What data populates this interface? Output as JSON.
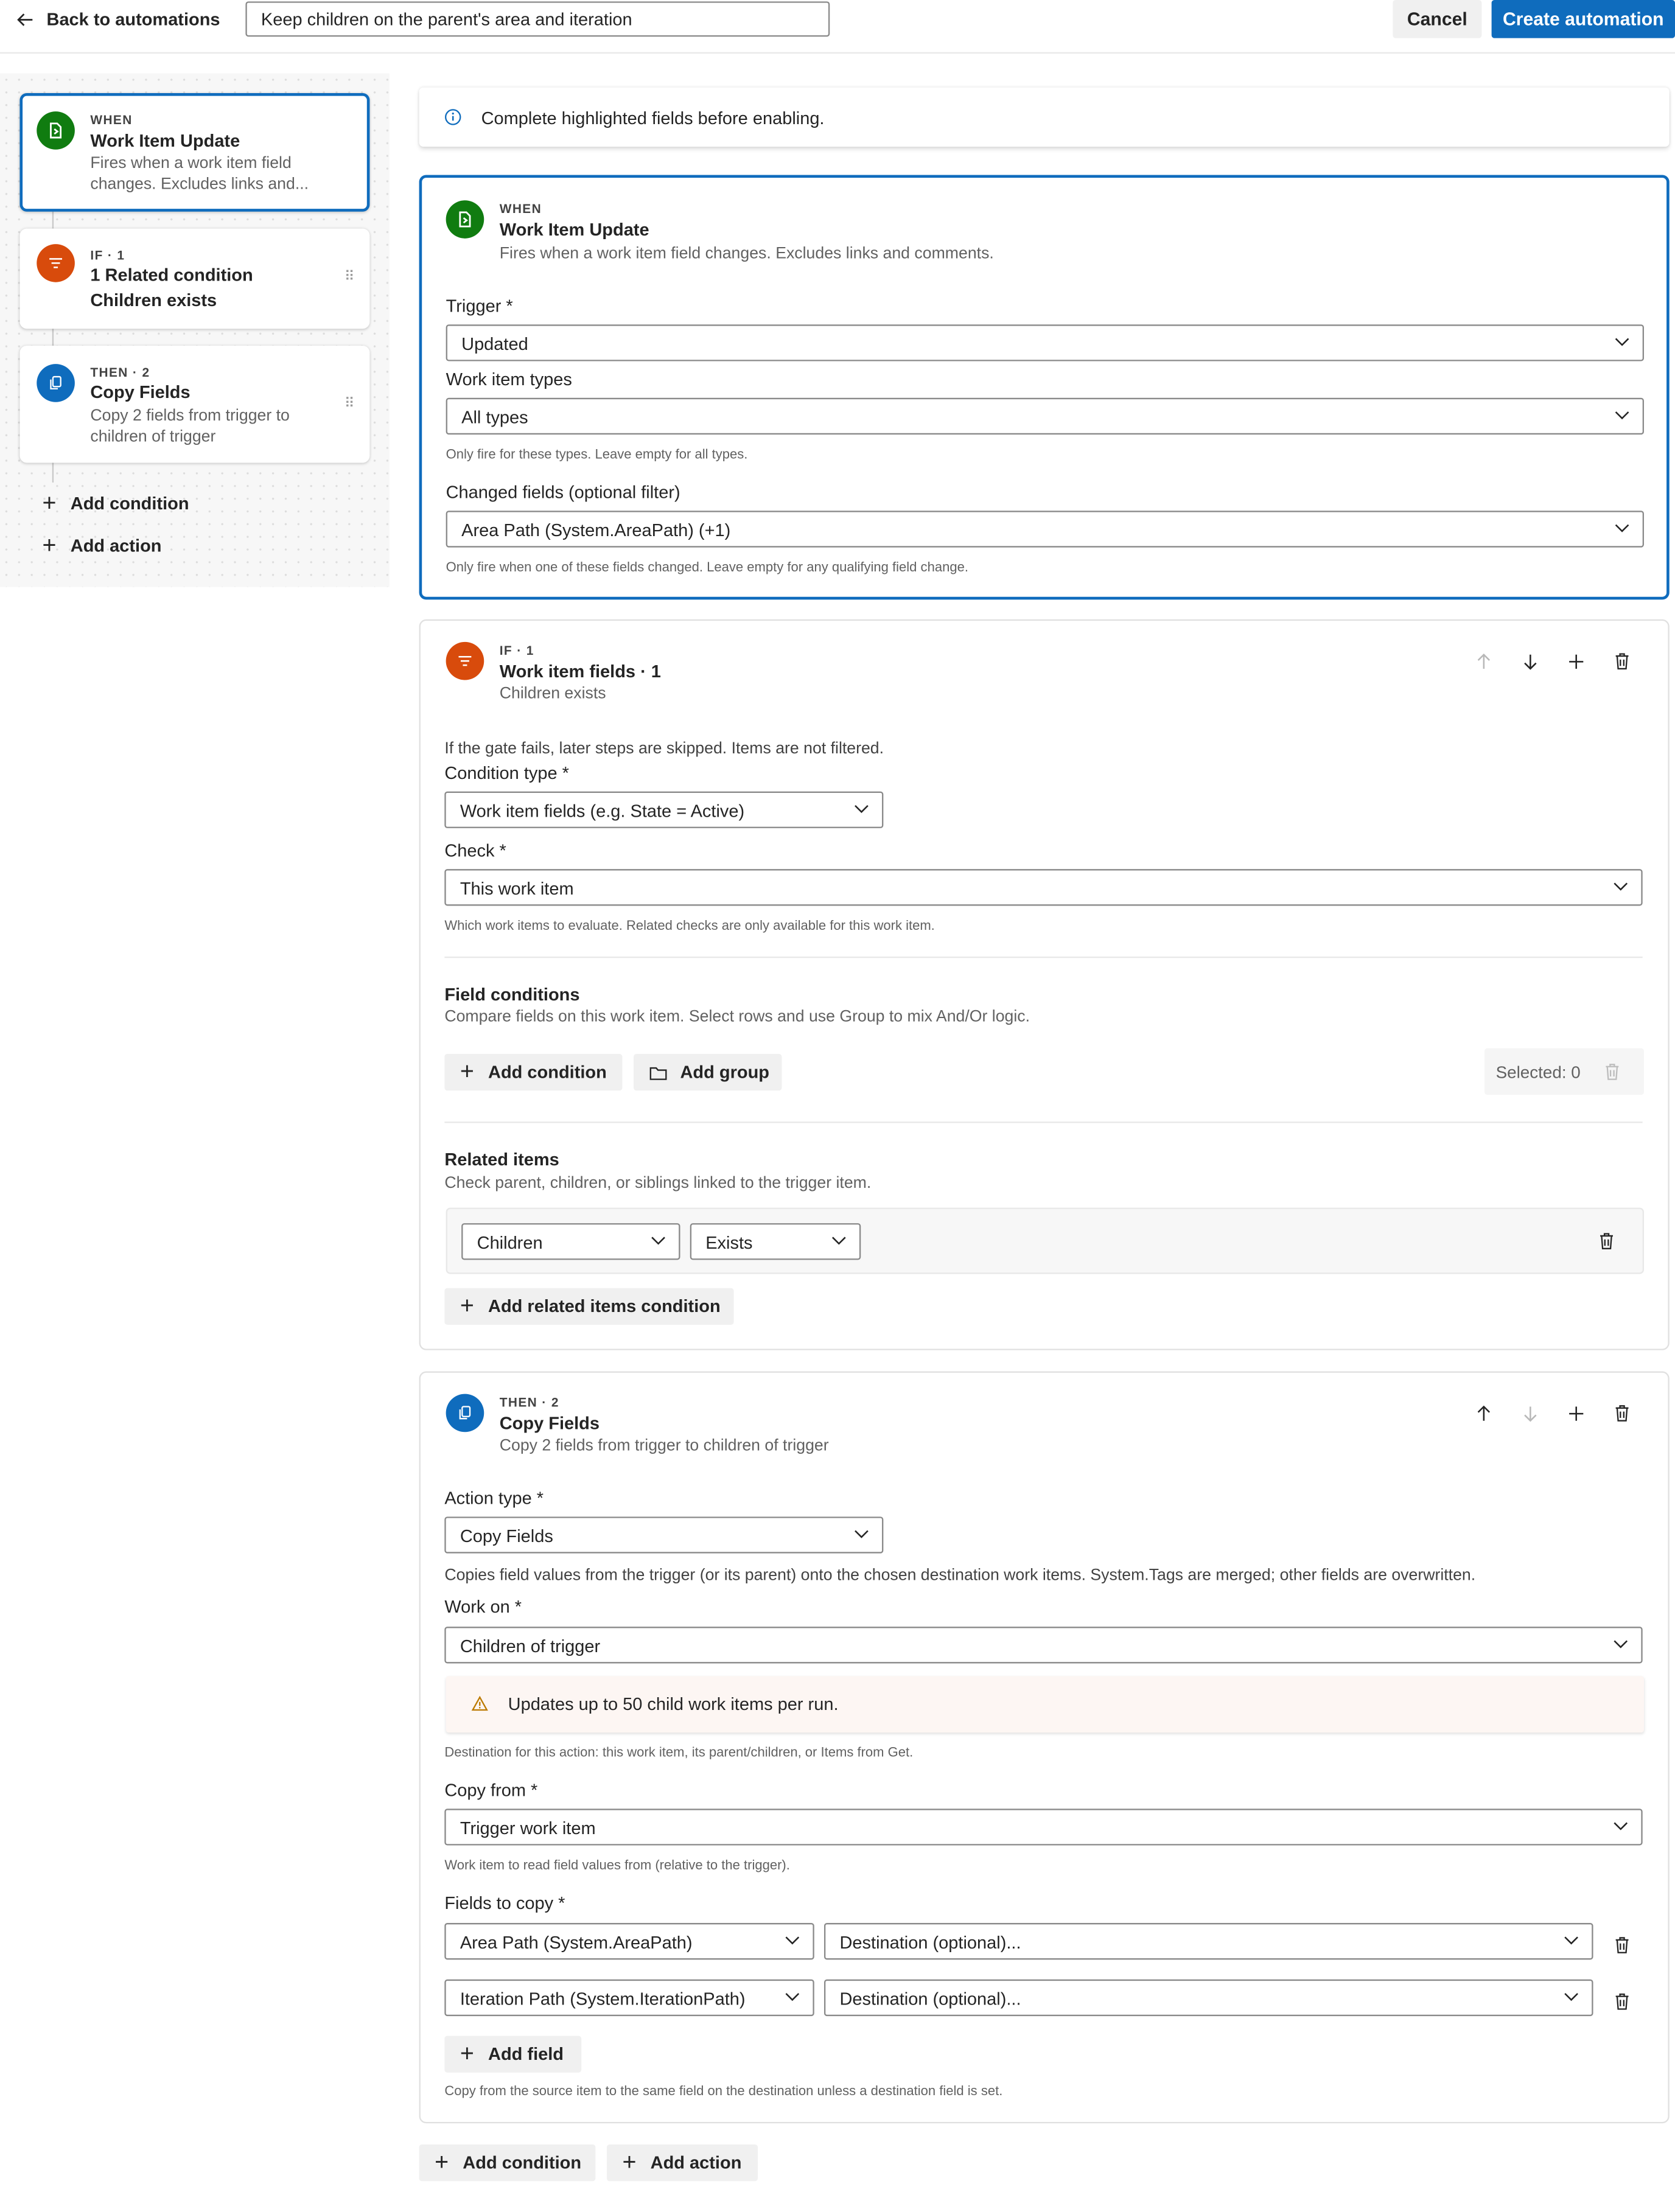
{
  "header": {
    "back_label": "Back to automations",
    "name_value": "Keep children on the parent's area and iteration",
    "cancel_label": "Cancel",
    "create_label": "Create automation"
  },
  "sidebar": {
    "items": [
      {
        "kicker": "WHEN",
        "title": "Work Item Update",
        "sub1": "Fires when a work item field",
        "sub2": "changes. Excludes links and..."
      },
      {
        "kicker": "IF · 1",
        "title": "1 Related condition",
        "title2": "Children exists"
      },
      {
        "kicker": "THEN · 2",
        "title": "Copy Fields",
        "sub1": "Copy 2 fields from trigger to",
        "sub2": "children of trigger"
      }
    ],
    "add_condition": "Add condition",
    "add_action": "Add action"
  },
  "info_banner": "Complete highlighted fields before enabling.",
  "when_card": {
    "kicker": "WHEN",
    "title": "Work Item Update",
    "subtitle": "Fires when a work item field changes. Excludes links and comments.",
    "trigger_label": "Trigger *",
    "trigger_value": "Updated",
    "types_label": "Work item types",
    "types_value": "All types",
    "types_help": "Only fire for these types. Leave empty for all types.",
    "changed_label": "Changed fields (optional filter)",
    "changed_value": "Area Path (System.AreaPath) (+1)",
    "changed_help": "Only fire when one of these fields changed. Leave empty for any qualifying field change."
  },
  "if_card": {
    "kicker": "IF · 1",
    "title": "Work item fields · 1",
    "subtitle": "Children exists",
    "gate_note": "If the gate fails, later steps are skipped. Items are not filtered.",
    "condition_type_label": "Condition type *",
    "condition_type_value": "Work item fields (e.g. State = Active)",
    "check_label": "Check *",
    "check_value": "This work item",
    "check_help": "Which work items to evaluate. Related checks are only available for this work item.",
    "field_conditions_title": "Field conditions",
    "field_conditions_sub": "Compare fields on this work item. Select rows and use Group to mix And/Or logic.",
    "add_condition": "Add condition",
    "add_group": "Add group",
    "selected_count": "Selected: 0",
    "related_title": "Related items",
    "related_sub": "Check parent, children, or siblings linked to the trigger item.",
    "related_relation": "Children",
    "related_op": "Exists",
    "add_related": "Add related items condition"
  },
  "then_card": {
    "kicker": "THEN · 2",
    "title": "Copy Fields",
    "subtitle": "Copy 2 fields from trigger to children of trigger",
    "action_type_label": "Action type *",
    "action_type_value": "Copy Fields",
    "action_desc": "Copies field values from the trigger (or its parent) onto the chosen destination work items. System.Tags are merged; other fields are overwritten.",
    "work_on_label": "Work on *",
    "work_on_value": "Children of trigger",
    "warning": "Updates up to 50 child work items per run.",
    "work_on_help": "Destination for this action: this work item, its parent/children, or Items from Get.",
    "copy_from_label": "Copy from *",
    "copy_from_value": "Trigger work item",
    "copy_from_help": "Work item to read field values from (relative to the trigger).",
    "fields_label": "Fields to copy *",
    "fields": [
      {
        "source": "Area Path (System.AreaPath)",
        "dest": "Destination (optional)..."
      },
      {
        "source": "Iteration Path (System.IterationPath)",
        "dest": "Destination (optional)..."
      }
    ],
    "add_field": "Add field",
    "fields_help": "Copy from the source item to the same field on the destination unless a destination field is set."
  },
  "footer": {
    "add_condition": "Add condition",
    "add_action": "Add action"
  },
  "colors": {
    "accent": "#0f6cbd",
    "when_green": "#107c10",
    "if_orange": "#d84b0c",
    "warning_bg": "#fdf6f3"
  }
}
